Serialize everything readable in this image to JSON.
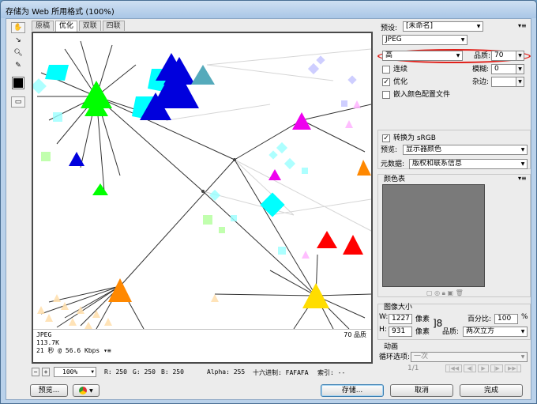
{
  "window": {
    "title": "存储为 Web 所用格式 (100%)"
  },
  "tabs": [
    "原稿",
    "优化",
    "双联",
    "四联"
  ],
  "active_tab_index": 1,
  "tools": [
    "hand-icon",
    "slice-select-icon",
    "zoom-icon",
    "eyedropper-icon"
  ],
  "preview_info": {
    "format": "JPEG",
    "size": "113.7K",
    "time": "21 秒 @ 56.6 Kbps",
    "quality": "70 品质"
  },
  "statusbar": {
    "zoom": "100%",
    "r": "R: 250",
    "g": "G: 250",
    "b": "B: 250",
    "alpha": "Alpha: 255",
    "hex": "十六进制: FAFAFA",
    "index": "索引: --"
  },
  "buttons": {
    "preview": "预览...",
    "save": "存储...",
    "cancel": "取消",
    "done": "完成"
  },
  "settings": {
    "preset_label": "预设:",
    "preset_value": "[未命名]",
    "format": "JPEG",
    "quality_preset": "高",
    "quality_label": "品质:",
    "quality_value": "70",
    "progressive_label": "连续",
    "progressive_checked": false,
    "blur_label": "模糊:",
    "blur_value": "0",
    "optimized_label": "优化",
    "optimized_checked": true,
    "matte_label": "杂边:",
    "embed_profile_label": "嵌入颜色配置文件",
    "embed_profile_checked": false,
    "convert_srgb_label": "转换为 sRGB",
    "convert_srgb_checked": true,
    "preview_label": "预览:",
    "preview_value": "显示器颜色",
    "metadata_label": "元数据:",
    "metadata_value": "版权和联系信息"
  },
  "color_table": {
    "title": "颜色表"
  },
  "image_size": {
    "title": "图像大小",
    "w_label": "W:",
    "w_value": "1227",
    "h_label": "H:",
    "h_value": "931",
    "unit": "像素",
    "percent_label": "百分比:",
    "percent_value": "100",
    "percent_unit": "%",
    "quality_label": "品质:",
    "quality_value": "两次立方"
  },
  "animation": {
    "title": "动画",
    "loop_label": "循环选项:",
    "loop_value": "一次",
    "frame": "1/1"
  },
  "colors": {
    "highlight_oval": "#e0201a",
    "window_bg": "#b9d1ea"
  }
}
